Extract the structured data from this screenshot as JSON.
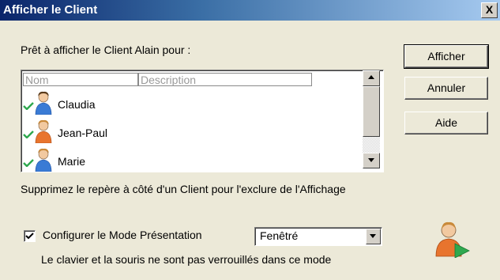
{
  "window": {
    "title": "Afficher le Client",
    "close_label": "X"
  },
  "prompt": "Prêt à afficher le Client Alain pour :",
  "list": {
    "columns": [
      "Nom",
      "Description"
    ],
    "rows": [
      {
        "name": "Claudia",
        "checked": true
      },
      {
        "name": "Jean-Paul",
        "checked": true
      },
      {
        "name": "Marie",
        "checked": true
      }
    ]
  },
  "buttons": {
    "show": "Afficher",
    "cancel": "Annuler",
    "help": "Aide"
  },
  "hint": "Supprimez le repère à côté d'un Client pour l'exclure de l'Affichage",
  "presentation": {
    "checkbox_label": "Configurer le Mode Présentation",
    "checked": true,
    "mode_value": "Fenêtré",
    "note": "Le clavier et la souris ne sont pas verrouillés dans ce mode"
  },
  "icons": {
    "check": "check-icon",
    "avatar": "user-avatar-icon",
    "show_client": "show-client-icon"
  },
  "colors": {
    "check_green": "#2FA84F",
    "title_blue": "#0A246A",
    "avatar_blue": "#3A7BD5",
    "avatar_orange": "#E8742E"
  }
}
